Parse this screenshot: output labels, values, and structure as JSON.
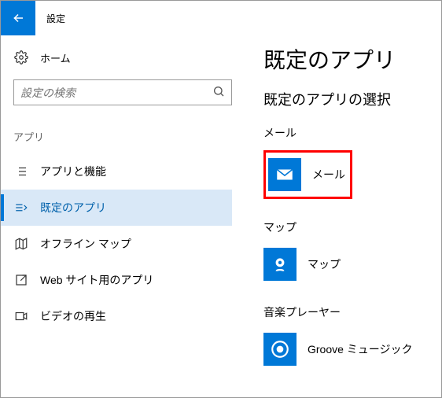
{
  "titlebar": {
    "title": "設定"
  },
  "sidebar": {
    "home": "ホーム",
    "search_placeholder": "設定の検索",
    "category": "アプリ",
    "items": [
      {
        "label": "アプリと機能"
      },
      {
        "label": "既定のアプリ"
      },
      {
        "label": "オフライン マップ"
      },
      {
        "label": "Web サイト用のアプリ"
      },
      {
        "label": "ビデオの再生"
      }
    ]
  },
  "main": {
    "title": "既定のアプリ",
    "subheading": "既定のアプリの選択",
    "sections": [
      {
        "label": "メール",
        "app": "メール"
      },
      {
        "label": "マップ",
        "app": "マップ"
      },
      {
        "label": "音楽プレーヤー",
        "app": "Groove ミュージック"
      }
    ]
  }
}
